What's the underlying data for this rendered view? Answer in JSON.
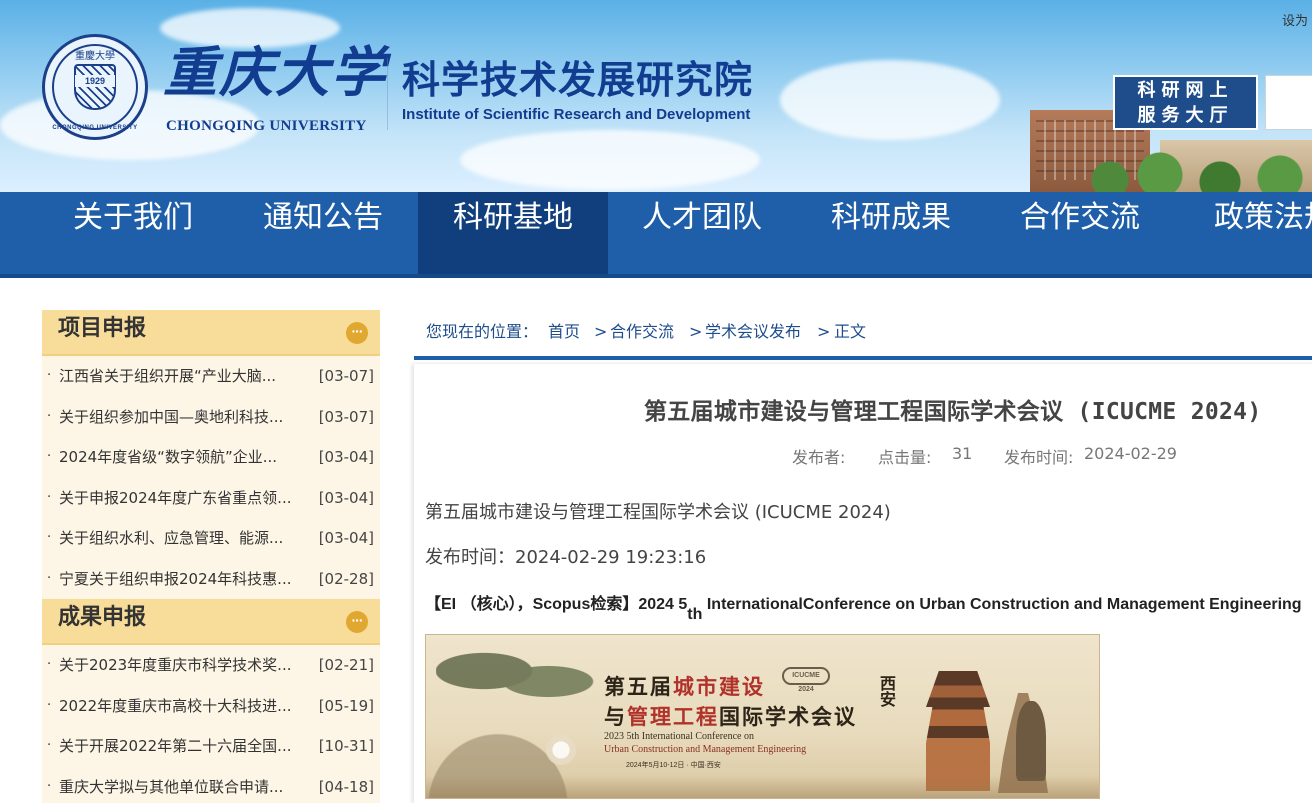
{
  "header": {
    "university_cn": "重庆大学",
    "university_en": "CHONGQING UNIVERSITY",
    "seal_year": "1929",
    "seal_top": "重慶大學",
    "seal_bottom": "CHONGQING UNIVERSITY",
    "institute_cn": "科学技术发展研究院",
    "institute_en": "Institute of Scientific Research and Development",
    "top_link": "设为",
    "service_line1": "科研网上",
    "service_line2": "服务大厅"
  },
  "nav": {
    "items": [
      "关于我们",
      "通知公告",
      "科研基地",
      "人才团队",
      "科研成果",
      "合作交流",
      "政策法规"
    ],
    "active_index": 2
  },
  "sidebar": {
    "section1": {
      "title": "项目申报",
      "more": "···",
      "items": [
        {
          "title": "江西省关于组织开展“产业大脑...",
          "date": "[03-07]"
        },
        {
          "title": "关于组织参加中国—奥地利科技...",
          "date": "[03-07]"
        },
        {
          "title": "2024年度省级“数字领航”企业...",
          "date": "[03-04]"
        },
        {
          "title": "关于申报2024年度广东省重点领...",
          "date": "[03-04]"
        },
        {
          "title": "关于组织水利、应急管理、能源...",
          "date": "[03-04]"
        },
        {
          "title": "宁夏关于组织申报2024年科技惠...",
          "date": "[02-28]"
        }
      ]
    },
    "section2": {
      "title": "成果申报",
      "more": "···",
      "items": [
        {
          "title": "关于2023年度重庆市科学技术奖...",
          "date": "[02-21]"
        },
        {
          "title": "2022年度重庆市高校十大科技进...",
          "date": "[05-19]"
        },
        {
          "title": "关于开展2022年第二十六届全国...",
          "date": "[10-31]"
        },
        {
          "title": "重庆大学拟与其他单位联合申请...",
          "date": "[04-18]"
        }
      ]
    },
    "bullet": "·"
  },
  "breadcrumb": {
    "label": "您现在的位置：",
    "items": [
      "首页",
      "合作交流",
      "学术会议发布",
      "正文"
    ],
    "separator": ">"
  },
  "article": {
    "title": "第五届城市建设与管理工程国际学术会议 (ICUCME 2024)",
    "meta_author_label": "发布者:",
    "meta_author": "",
    "meta_views_label": "点击量:",
    "meta_views": "31",
    "meta_time_label": "发布时间:",
    "meta_time": "2024-02-29",
    "para1": "第五届城市建设与管理工程国际学术会议 (ICUCME 2024)",
    "para2": "发布时间：2024-02-29 19:23:16",
    "bold_prefix": "【EI （核心），Scopus检索】2024 5",
    "bold_sub": "th",
    "bold_suffix": " InternationalConference on Urban Construction and Management Engineering",
    "banner": {
      "title_a": "第五届",
      "title_b": "城市建设",
      "title_c": "与",
      "title_d": "管理工程",
      "title_e": "国际学术会议",
      "en1": "2023 5th International Conference on",
      "en2": "Urban Construction and Management Engineering",
      "date": "2024年5月10-12日 · 中国·西安",
      "badge": "ICUCME 2024",
      "city": "西安"
    }
  },
  "colors": {
    "nav_bg": "#1f5ea8",
    "nav_active": "#113f7d",
    "side_head": "#f7dc9a",
    "side_bg": "#fdf6e6",
    "brand_blue": "#123c8f"
  }
}
